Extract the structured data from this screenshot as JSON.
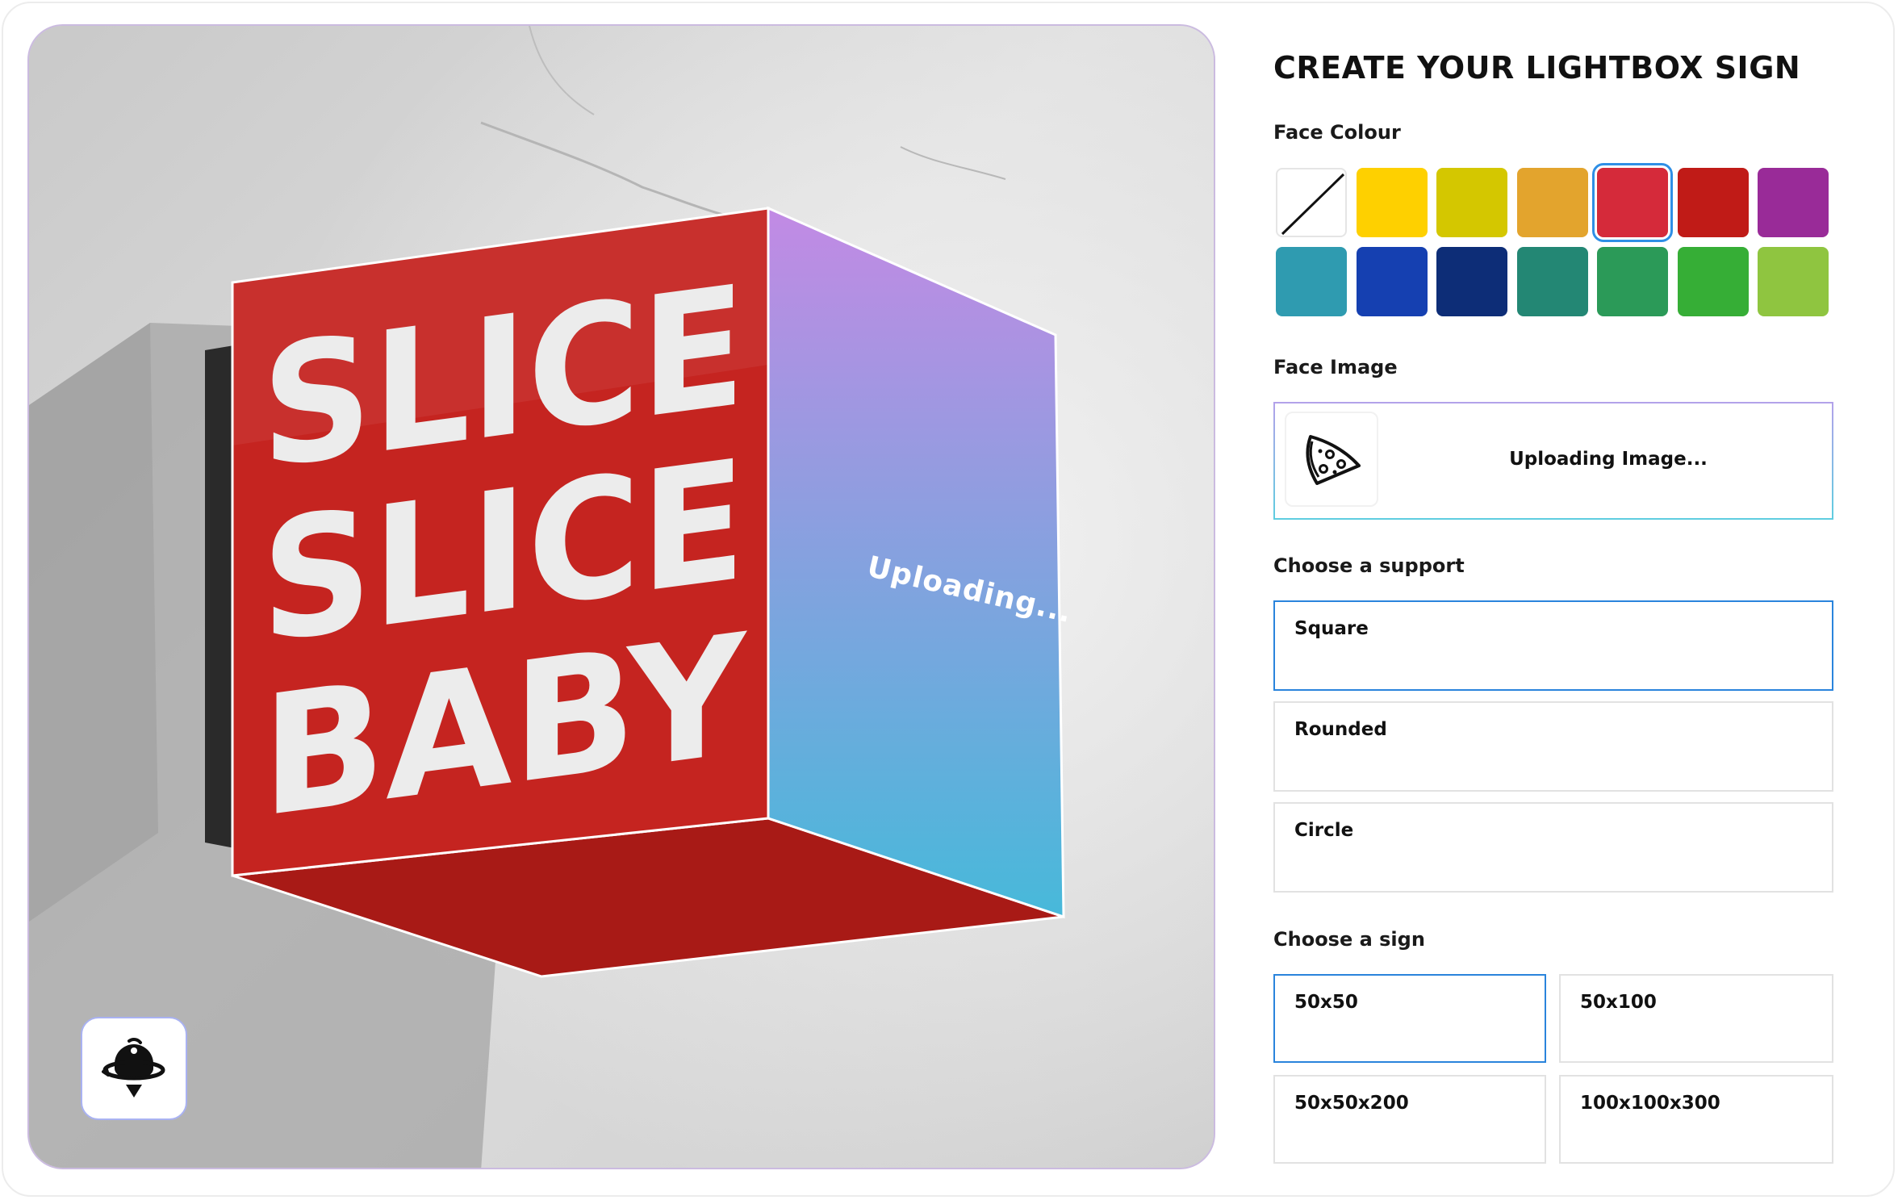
{
  "panel": {
    "title": "CREATE YOUR LIGHTBOX SIGN",
    "face_colour_label": "Face Colour",
    "face_image_label": "Face Image",
    "support_label": "Choose a support",
    "sign_label": "Choose a sign"
  },
  "colours": {
    "selected": "#d52a3a",
    "swatches": [
      {
        "name": "none",
        "hex": "#ffffff"
      },
      {
        "name": "yellow",
        "hex": "#fed000"
      },
      {
        "name": "olive-yellow",
        "hex": "#d4c700"
      },
      {
        "name": "amber",
        "hex": "#e3a42d"
      },
      {
        "name": "red",
        "hex": "#d52a3a"
      },
      {
        "name": "dark-red",
        "hex": "#c01b17"
      },
      {
        "name": "purple",
        "hex": "#992b98"
      },
      {
        "name": "teal",
        "hex": "#2f9bb0"
      },
      {
        "name": "blue",
        "hex": "#1540b1"
      },
      {
        "name": "navy",
        "hex": "#0d2d77"
      },
      {
        "name": "deep-teal",
        "hex": "#238774"
      },
      {
        "name": "green",
        "hex": "#2b9a58"
      },
      {
        "name": "bright-green",
        "hex": "#36ae36"
      },
      {
        "name": "lime",
        "hex": "#8fc540"
      }
    ]
  },
  "upload": {
    "status": "Uploading Image...",
    "thumb_icon": "pizza-slice-icon"
  },
  "support_options": [
    {
      "label": "Square",
      "selected": true
    },
    {
      "label": "Rounded",
      "selected": false
    },
    {
      "label": "Circle",
      "selected": false
    }
  ],
  "sign_options": [
    {
      "label": "50x50",
      "selected": true
    },
    {
      "label": "50x100",
      "selected": false
    },
    {
      "label": "50x50x200",
      "selected": false
    },
    {
      "label": "100x100x300",
      "selected": false
    }
  ],
  "preview": {
    "sign_lines": [
      "SLICE",
      "SLICE",
      "BABY"
    ],
    "side_status": "Uploading...",
    "rotate_icon": "rotate-3d-icon",
    "colors": {
      "front_face": "#c52420",
      "bottom_face": "#a81a16",
      "side_top": "#c28ae4",
      "side_bottom": "#47b9da",
      "lettering": "#ececec"
    }
  }
}
